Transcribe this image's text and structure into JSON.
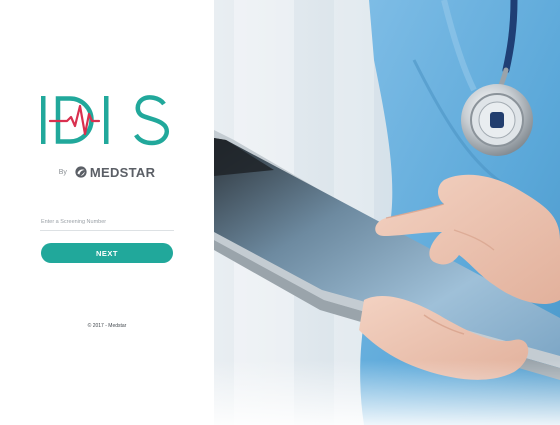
{
  "login": {
    "logo_text": "IDIS",
    "byline_prefix": "By",
    "company_name": "MEDSTAR",
    "screening_field": {
      "placeholder": "Enter a Screening Number",
      "value": ""
    },
    "next_label": "NEXT",
    "copyright": "© 2017 - Medstar"
  },
  "colors": {
    "brand_teal": "#21a89b",
    "pulse_red": "#d9304f",
    "scrub_blue": "#5ba8d9"
  },
  "hero": {
    "image_subject": "clinician-with-tablet-and-stethoscope"
  }
}
